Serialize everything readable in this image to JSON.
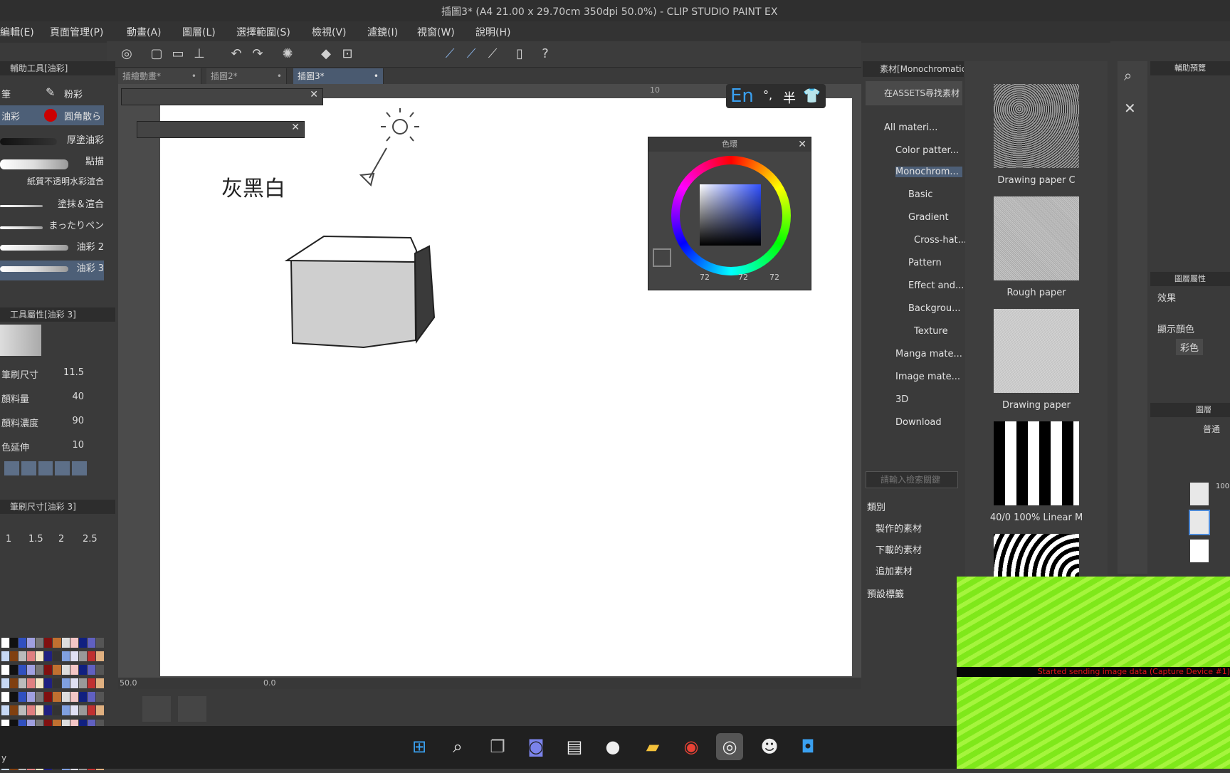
{
  "window": {
    "title": "插圖3* (A4 21.00 x 29.70cm 350dpi 50.0%) - CLIP STUDIO PAINT EX"
  },
  "menu": [
    "編輯(E)",
    "頁面管理(P)",
    "動畫(A)",
    "圖層(L)",
    "選擇範圍(S)",
    "檢視(V)",
    "濾鏡(I)",
    "視窗(W)",
    "說明(H)"
  ],
  "tabs": [
    {
      "label": "插繪動畫*",
      "dot": "•"
    },
    {
      "label": "插圖2*",
      "dot": "•"
    },
    {
      "label": "插圖3*",
      "dot": "•"
    }
  ],
  "left_panel": {
    "subtool_header": "輔助工具[油彩]",
    "subtool_groups": [
      "筆",
      "粉彩"
    ],
    "subtool_active": "油彩",
    "subtool_brush_label": "圓角散ら",
    "brushes": [
      "厚塗油彩",
      "點描",
      "紙質不透明水彩渲合",
      "塗抹＆渲合",
      "まったりペン",
      "油彩 2",
      "油彩 3"
    ],
    "tool_property_header": "工具屬性[油彩 3]",
    "properties": [
      {
        "label": "筆刷尺寸",
        "value": "11.5"
      },
      {
        "label": "顏料量",
        "value": "40"
      },
      {
        "label": "顏料濃度",
        "value": "90"
      },
      {
        "label": "色延伸",
        "value": "10"
      }
    ],
    "brush_size_header": "筆刷尺寸[油彩 3]",
    "brush_sizes": [
      "1",
      "1.5",
      "2",
      "2.5"
    ]
  },
  "canvas": {
    "handwriting": "灰黑白",
    "ruler_mark": "10",
    "zoom": "50.0",
    "angle": "0.0"
  },
  "ime": {
    "lang": "En",
    "punct": "°,",
    "width": "半"
  },
  "color_wheel": {
    "title": "色環",
    "r": "72",
    "g": "72",
    "b": "72"
  },
  "material_panel": {
    "header": "素材[Monochromatic pattern]",
    "assets_button": "在ASSETS尋找素材",
    "tree": [
      "All materi...",
      "Color patter...",
      "Monochrom...",
      "Basic",
      "Gradient",
      "Cross-hat...",
      "Pattern",
      "Effect and...",
      "Backgrou...",
      "Texture",
      "Manga mate...",
      "Image mate...",
      "3D",
      "Download"
    ],
    "search_placeholder": "請輸入檢索關鍵",
    "category_label": "類別",
    "category_items": [
      "製作的素材",
      "下載的素材",
      "追加素材"
    ],
    "preset_tags": "預設標籤"
  },
  "thumbnails": [
    "Drawing paper C",
    "Rough paper",
    "Drawing paper",
    "40/0 100% Linear M"
  ],
  "right_panel": {
    "navigator": "輔助預覽",
    "layer_property": "圖層屬性",
    "effect": "效果",
    "display_color_label": "顯示顏色",
    "display_color": "彩色",
    "layer_tab": "圖層",
    "blend": "普通",
    "layer_opacity": "100"
  },
  "capture_message": "Started sending image data (Capture Device #1)",
  "taskbar_left_text": "y"
}
